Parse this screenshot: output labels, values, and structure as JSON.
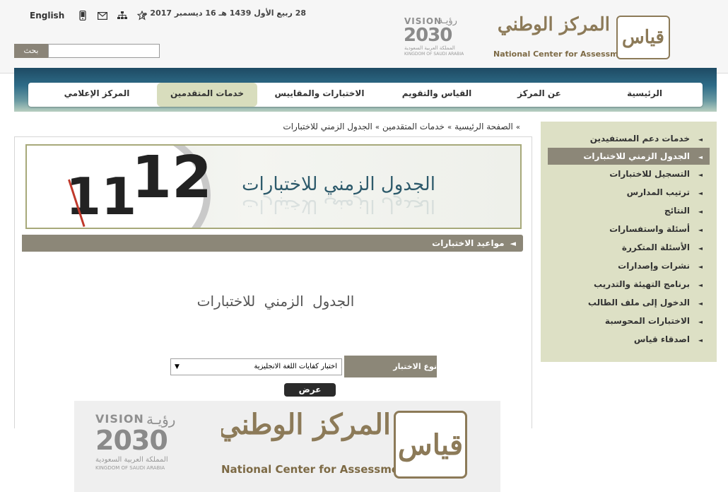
{
  "header": {
    "language_link": "English",
    "icons": [
      "mobile-icon",
      "mail-icon",
      "sitemap-icon",
      "star-icon"
    ],
    "date": "28 ربيع الأول 1439 هـ 16 ديسمبر 2017 م",
    "search": {
      "button_label": "بحث",
      "placeholder": ""
    },
    "vision": {
      "arabic": "رؤيـة",
      "word": "VISION",
      "year": "2030",
      "sub_ar": "المملكة العربية السعودية",
      "sub_en": "KINGDOM OF SAUDI ARABIA"
    },
    "brand": {
      "arabic": "المركز الوطني للقياس",
      "english": "National Center for Assessment",
      "mark": "قياس"
    }
  },
  "nav": {
    "items": [
      {
        "label": "الرئيسية",
        "active": false
      },
      {
        "label": "عن المركز",
        "active": false
      },
      {
        "label": "القياس والتقويم",
        "active": false
      },
      {
        "label": "الاختبارات والمقاييس",
        "active": false
      },
      {
        "label": "خدمات المتقدمين",
        "active": true
      },
      {
        "label": "المركز الإعلامي",
        "active": false
      }
    ]
  },
  "sidebar": {
    "items": [
      {
        "label": "خدمات دعم المستفيدين",
        "active": false
      },
      {
        "label": "الجدول الزمني للاختبارات",
        "active": true
      },
      {
        "label": "التسجيل للاختبارات",
        "active": false
      },
      {
        "label": "ترتيب المدارس",
        "active": false
      },
      {
        "label": "النتائج",
        "active": false
      },
      {
        "label": "أسئلة واستفسارات",
        "active": false
      },
      {
        "label": "الأسئلة المتكررة",
        "active": false
      },
      {
        "label": "نشرات وإصدارات",
        "active": false
      },
      {
        "label": "برنامج التهيئة والتدريب",
        "active": false
      },
      {
        "label": "الدخول إلى ملف الطالب",
        "active": false
      },
      {
        "label": "الاختبارات المحوسبة",
        "active": false
      },
      {
        "label": "اصدقاء قياس",
        "active": false
      }
    ]
  },
  "breadcrumb": [
    "الصفحة الرئيسية",
    "خدمات المتقدمين",
    "الجدول الزمني للاختبارات"
  ],
  "banner": {
    "title": "الجدول الزمني للاختبارات",
    "clock_numbers": [
      "11",
      "12"
    ]
  },
  "section": {
    "title": "مواعيد الاختبارات"
  },
  "page_title": "الجدول الزمني للاختبارات",
  "form": {
    "type_label": "نوع الاختبار",
    "selected": "اختبار كفايات اللغة الانجليزية",
    "submit_label": "عرض"
  },
  "footer": {
    "brand_arabic": "المركز الوطني للقياس",
    "brand_english": "National Center for Assessment",
    "mark": "قياس",
    "vision": {
      "arabic": "رؤيـة",
      "word": "VISION",
      "year": "2030",
      "sub_ar": "المملكة العربية السعودية",
      "sub_en": "KINGDOM OF SAUDI ARABIA"
    }
  },
  "colors": {
    "accent": "#8c8778",
    "brand": "#8c7a58",
    "nav_dark": "#1e4a63",
    "sidebar_bg": "#dde0c5",
    "nav_active": "#d8ddbd"
  }
}
